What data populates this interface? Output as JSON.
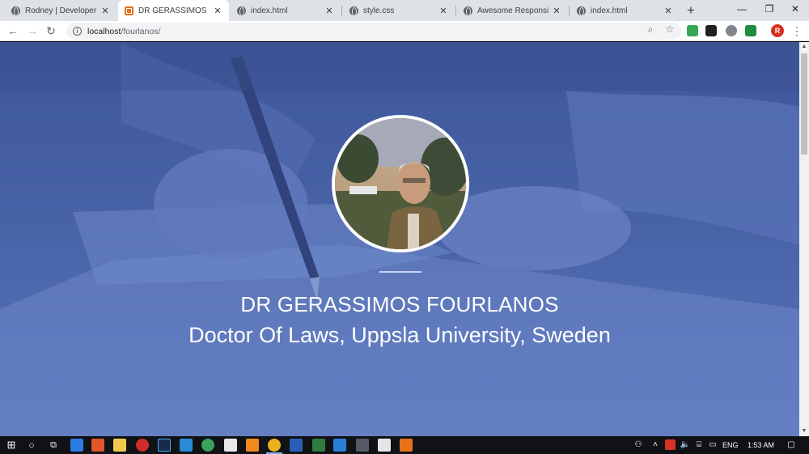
{
  "browser": {
    "tabs": [
      {
        "title": "Rodney | Developer",
        "icon": "globe-icon",
        "active": false
      },
      {
        "title": "DR GERASSIMOS FOUR",
        "icon": "brand-icon",
        "active": true
      },
      {
        "title": "index.html",
        "icon": "globe-icon",
        "active": false
      },
      {
        "title": "style.css",
        "icon": "globe-icon",
        "active": false
      },
      {
        "title": "Awesome Responsive T",
        "icon": "globe-icon",
        "active": false
      },
      {
        "title": "index.html",
        "icon": "globe-icon",
        "active": false
      }
    ],
    "new_tab_label": "+",
    "window_controls": {
      "minimize": "—",
      "restore": "❐",
      "close": "✕"
    },
    "address": {
      "host": "localhost",
      "path": "/fourlanos/"
    },
    "profile_initial": "R"
  },
  "page": {
    "name": "DR GERASSIMOS FOURLANOS",
    "subtitle": "Doctor Of Laws, Uppsla University, Sweden",
    "accent_color": "#4a63a5"
  },
  "taskbar": {
    "language": "ENG",
    "time": "1:53 AM"
  }
}
